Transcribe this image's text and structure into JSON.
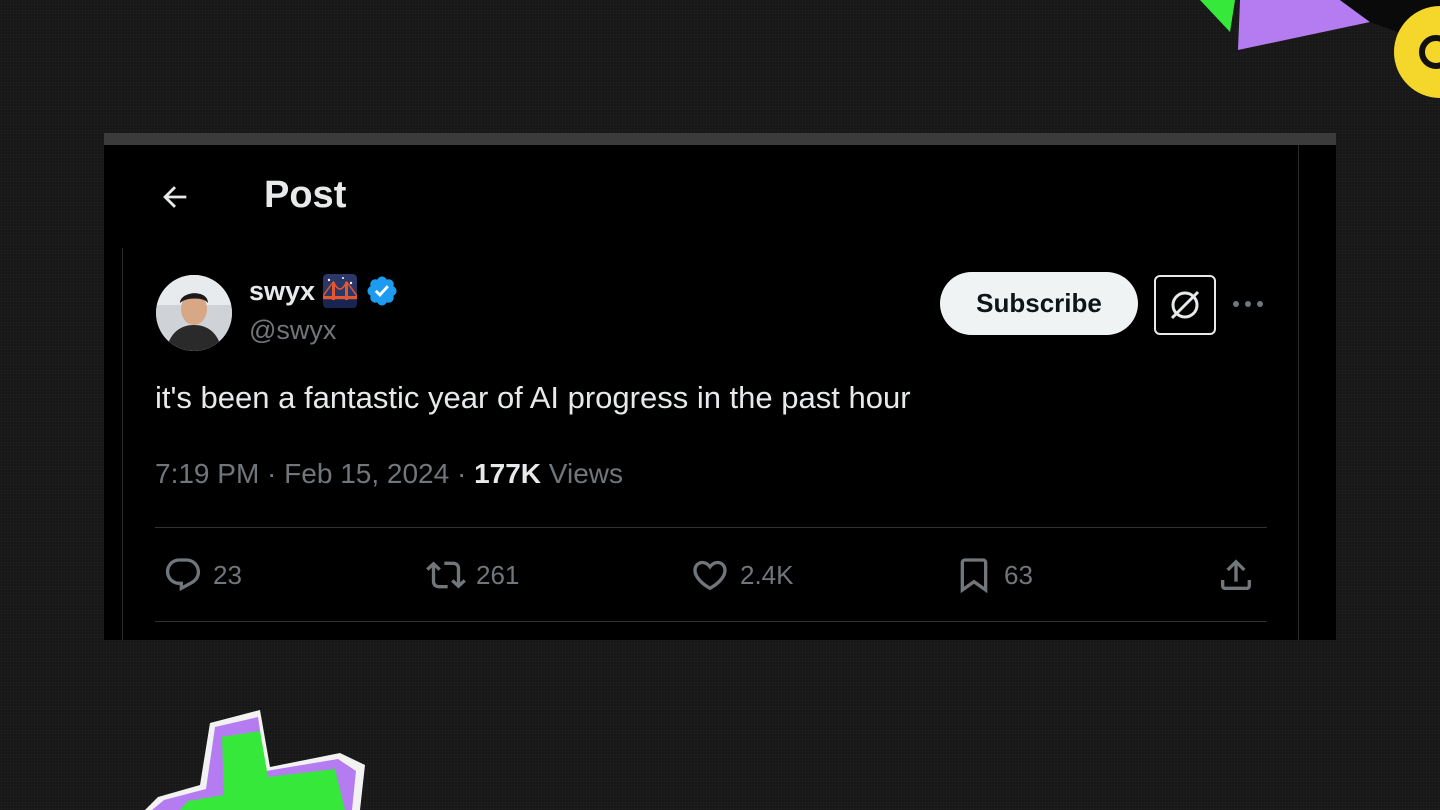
{
  "header": {
    "title": "Post"
  },
  "author": {
    "name": "swyx",
    "handle": "@swyx",
    "icons": [
      "bridge-night-emoji",
      "verified-badge-icon"
    ]
  },
  "actions_top": {
    "subscribe_label": "Subscribe"
  },
  "post": {
    "text": "it's been a fantastic year of AI progress in the past hour",
    "time": "7:19 PM",
    "sep1": " · ",
    "date": "Feb 15, 2024",
    "sep2": " · ",
    "views_count": "177K",
    "views_label": " Views"
  },
  "engagement": {
    "replies": "23",
    "reposts": "261",
    "likes": "2.4K",
    "bookmarks": "63"
  },
  "colors": {
    "background": "#171717",
    "card": "#000000",
    "text": "#e7e9ea",
    "muted": "#71767b",
    "verified": "#1d9bf0",
    "deco_green": "#35e83a",
    "deco_purple": "#b57cf2",
    "deco_yellow": "#f5d62a"
  }
}
